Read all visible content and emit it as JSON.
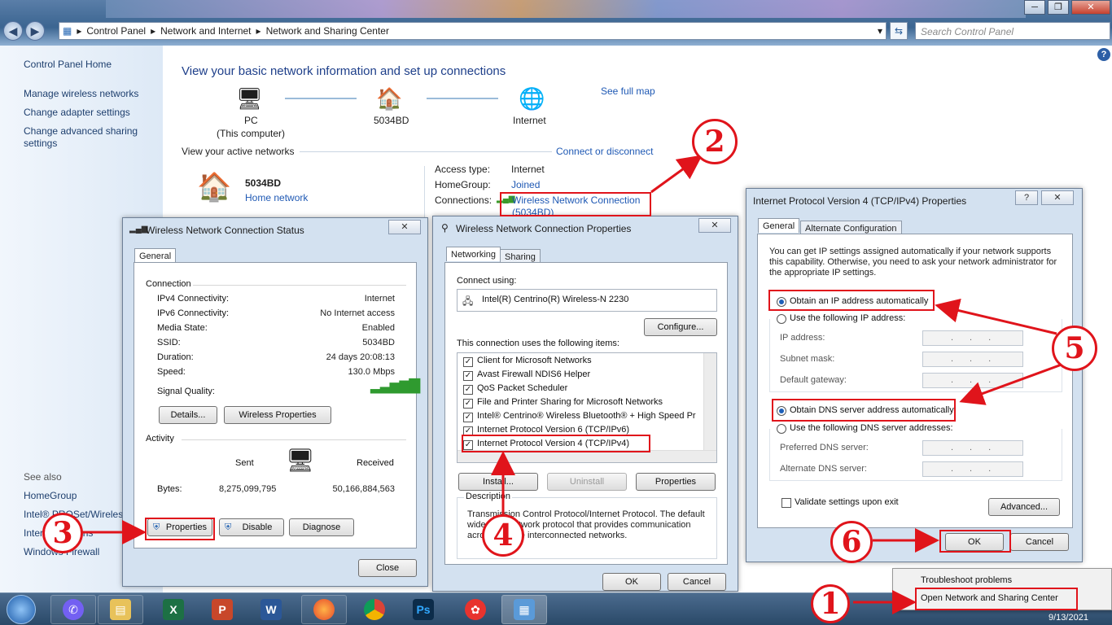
{
  "explorer": {
    "breadcrumb": [
      "Control Panel",
      "Network and Internet",
      "Network and Sharing Center"
    ],
    "search_placeholder": "Search Control Panel",
    "left_links": [
      "Control Panel Home",
      "Manage wireless networks",
      "Change adapter settings",
      "Change advanced sharing settings"
    ],
    "see_also_title": "See also",
    "see_also": [
      "HomeGroup",
      "Intel® PROSet/Wireless",
      "Internet Options",
      "Windows Firewall"
    ],
    "heading": "View your basic network information and set up connections",
    "see_full_map": "See full map",
    "map_nodes": [
      {
        "label": "PC",
        "sub": "(This computer)"
      },
      {
        "label": "5034BD"
      },
      {
        "label": "Internet"
      }
    ],
    "active_networks_title": "View your active networks",
    "connect_link": "Connect or disconnect",
    "network_name": "5034BD",
    "network_type": "Home network",
    "access_type_label": "Access type:",
    "access_type": "Internet",
    "homegroup_label": "HomeGroup:",
    "homegroup": "Joined",
    "connections_label": "Connections:",
    "connection_name": "Wireless Network Connection",
    "connection_ssid": "(5034BD)"
  },
  "status_dialog": {
    "title": "Wireless Network Connection Status",
    "tab": "General",
    "connection_section": "Connection",
    "rows": [
      {
        "label": "IPv4 Connectivity:",
        "value": "Internet"
      },
      {
        "label": "IPv6 Connectivity:",
        "value": "No Internet access"
      },
      {
        "label": "Media State:",
        "value": "Enabled"
      },
      {
        "label": "SSID:",
        "value": "5034BD"
      },
      {
        "label": "Duration:",
        "value": "24 days 20:08:13"
      },
      {
        "label": "Speed:",
        "value": "130.0 Mbps"
      }
    ],
    "signal_label": "Signal Quality:",
    "details_btn": "Details...",
    "wireless_props_btn": "Wireless Properties",
    "activity_section": "Activity",
    "sent_label": "Sent",
    "received_label": "Received",
    "bytes_label": "Bytes:",
    "bytes_sent": "8,275,099,795",
    "bytes_received": "50,166,884,563",
    "properties_btn": "Properties",
    "disable_btn": "Disable",
    "diagnose_btn": "Diagnose",
    "close_btn": "Close"
  },
  "props_dialog": {
    "title": "Wireless Network Connection Properties",
    "tabs": [
      "Networking",
      "Sharing"
    ],
    "connect_using": "Connect using:",
    "adapter": "Intel(R) Centrino(R) Wireless-N 2230",
    "configure_btn": "Configure...",
    "items_title": "This connection uses the following items:",
    "items": [
      "Client for Microsoft Networks",
      "Avast Firewall NDIS6 Helper",
      "QoS Packet Scheduler",
      "File and Printer Sharing for Microsoft Networks",
      "Intel® Centrino® Wireless Bluetooth® + High Speed Pr",
      "Internet Protocol Version 6 (TCP/IPv6)",
      "Internet Protocol Version 4 (TCP/IPv4)"
    ],
    "install_btn": "Install...",
    "uninstall_btn": "Uninstall",
    "properties_btn": "Properties",
    "description_title": "Description",
    "description": "Transmission Control Protocol/Internet Protocol. The default wide area network protocol that provides communication across diverse interconnected networks.",
    "ok_btn": "OK",
    "cancel_btn": "Cancel"
  },
  "ipv4_dialog": {
    "title": "Internet Protocol Version 4 (TCP/IPv4) Properties",
    "tabs": [
      "General",
      "Alternate Configuration"
    ],
    "intro": "You can get IP settings assigned automatically if your network supports this capability. Otherwise, you need to ask your network administrator for the appropriate IP settings.",
    "obtain_ip": "Obtain an IP address automatically",
    "use_ip": "Use the following IP address:",
    "ip_fields": [
      "IP address:",
      "Subnet mask:",
      "Default gateway:"
    ],
    "obtain_dns": "Obtain DNS server address automatically",
    "use_dns": "Use the following DNS server addresses:",
    "dns_fields": [
      "Preferred DNS server:",
      "Alternate DNS server:"
    ],
    "validate": "Validate settings upon exit",
    "advanced_btn": "Advanced...",
    "ok_btn": "OK",
    "cancel_btn": "Cancel"
  },
  "context_menu": [
    "Troubleshoot problems",
    "Open Network and Sharing Center"
  ],
  "taskbar": {
    "date": "9/13/2021"
  },
  "annotations": [
    "1",
    "2",
    "3",
    "4",
    "5",
    "6"
  ]
}
